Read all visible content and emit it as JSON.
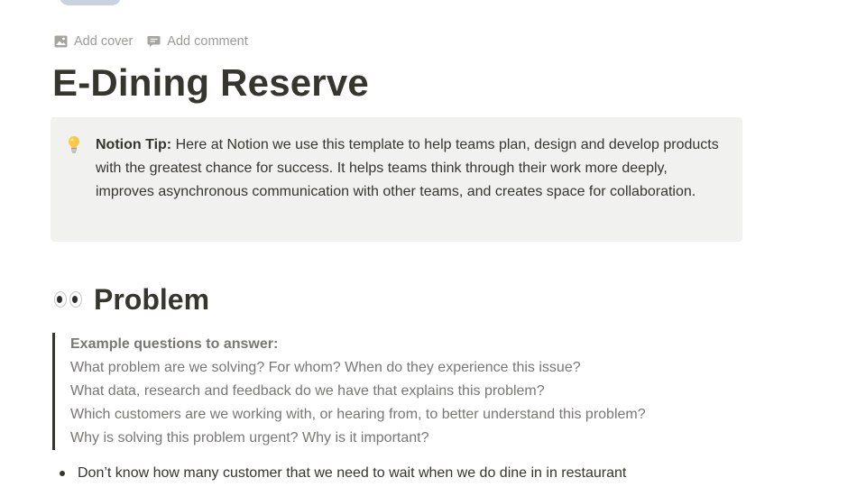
{
  "page": {
    "title": "E-Dining Reserve",
    "controls": {
      "add_cover": "Add cover",
      "add_comment": "Add comment"
    }
  },
  "callout": {
    "icon": "lightbulb-icon",
    "label": "Notion Tip:",
    "text": " Here at Notion we use this template to help teams plan, design and develop products with the greatest chance for success. It helps teams think through their work more deeply, improves asynchronous communication with other teams, and creates space for collaboration."
  },
  "problem": {
    "icon": "eyes-icon",
    "heading": "Problem",
    "quote": {
      "title": "Example questions to answer:",
      "lines": [
        "What problem are we solving? For whom? When do they experience this issue?",
        "What data, research and feedback do we have that explains this problem?",
        "Which customers are we working with, or hearing from, to better understand this problem?",
        "Why is solving this problem urgent? Why is it important?"
      ]
    },
    "bullets": [
      "Don’t know how many customer that we need to wait when we do dine in in restaurant"
    ]
  },
  "colors": {
    "text": "#37352f",
    "muted": "#9b9a97",
    "quote_text": "#787774",
    "callout_bg": "#f1f1ef"
  }
}
